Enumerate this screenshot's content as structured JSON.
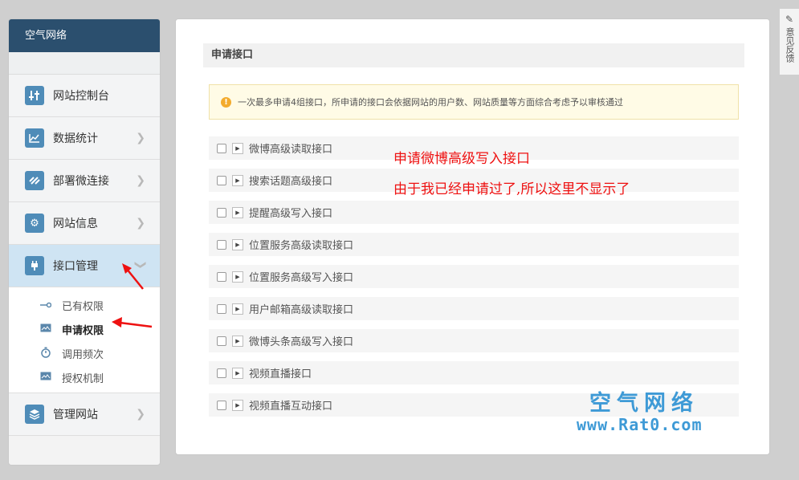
{
  "sidebar": {
    "brand": "空气网络",
    "items": [
      {
        "label": "网站控制台",
        "icon": "sliders-icon"
      },
      {
        "label": "数据统计",
        "icon": "chart-icon"
      },
      {
        "label": "部署微连接",
        "icon": "link-icon"
      },
      {
        "label": "网站信息",
        "icon": "gear-icon"
      },
      {
        "label": "接口管理",
        "icon": "plug-icon"
      },
      {
        "label": "管理网站",
        "icon": "layers-icon"
      }
    ],
    "sub_items": [
      {
        "label": "已有权限",
        "icon": "key-icon"
      },
      {
        "label": "申请权限",
        "icon": "image-icon"
      },
      {
        "label": "调用频次",
        "icon": "stopwatch-icon"
      },
      {
        "label": "授权机制",
        "icon": "image-icon"
      }
    ]
  },
  "main": {
    "section_title": "申请接口",
    "notice": "一次最多申请4组接口，所申请的接口会依据网站的用户数、网站质量等方面综合考虑予以审核通过",
    "apis": [
      "微博高级读取接口",
      "搜索话题高级接口",
      "提醒高级写入接口",
      "位置服务高级读取接口",
      "位置服务高级写入接口",
      "用户邮箱高级读取接口",
      "微博头条高级写入接口",
      "视频直播接口",
      "视频直播互动接口"
    ]
  },
  "annotations": {
    "line1": "申请微博高级写入接口",
    "line2": "由于我已经申请过了,所以这里不显示了"
  },
  "watermark": {
    "title": "空气网络",
    "url": "www.Rat0.com"
  },
  "feedback": {
    "label": "意见反馈"
  },
  "colors": {
    "brand_bg": "#2b4f6e",
    "accent": "#4f8cb8",
    "annotation": "#e11111",
    "watermark": "#3e9ad6"
  }
}
